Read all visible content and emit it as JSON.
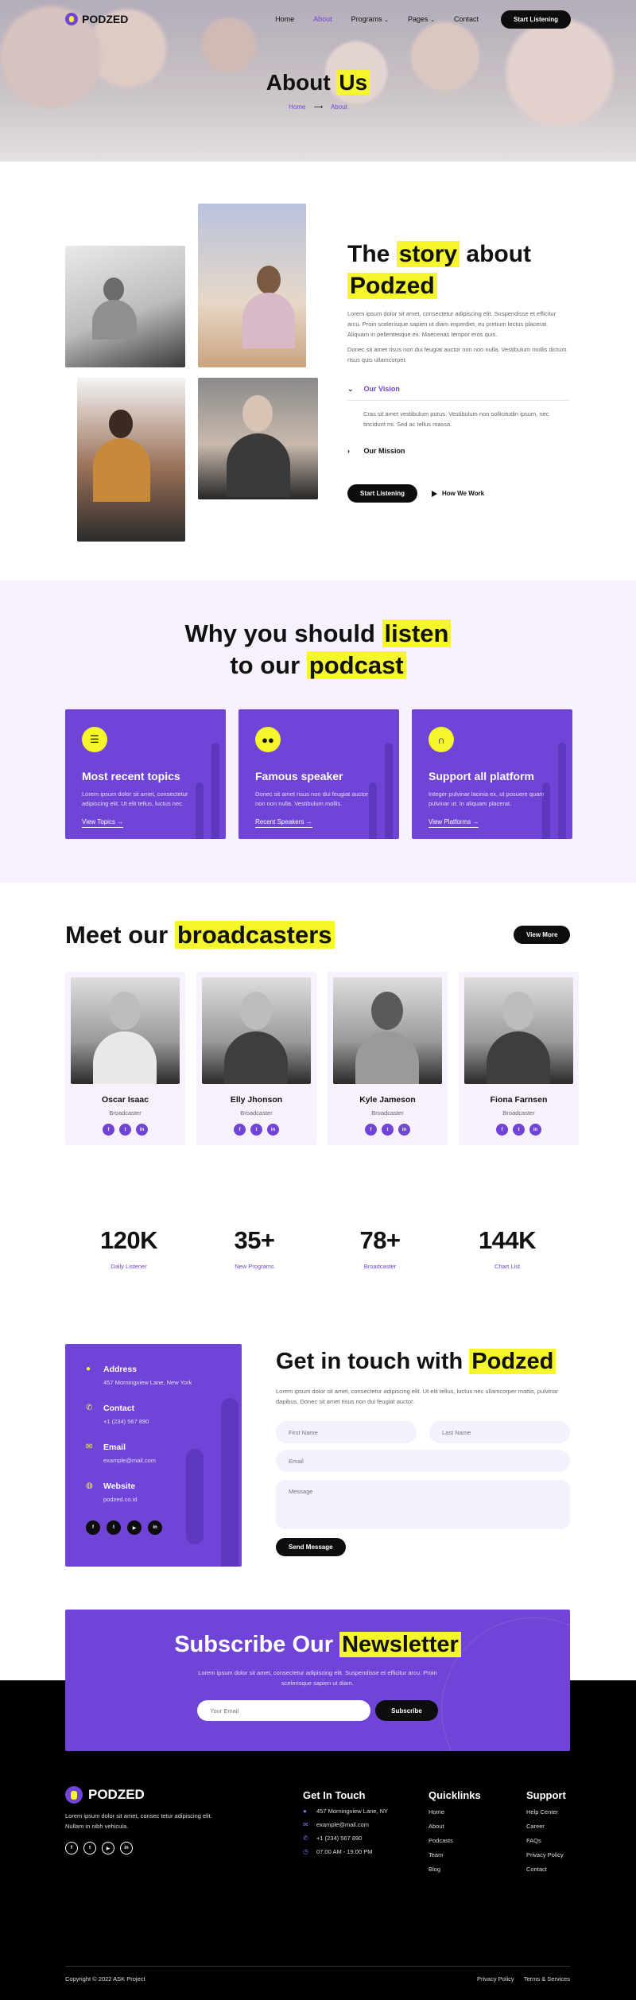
{
  "nav": {
    "logo": "PODZED",
    "items": [
      "Home",
      "About",
      "Programs",
      "Pages",
      "Contact"
    ],
    "cta": "Start Listening"
  },
  "hero": {
    "title_plain": "About",
    "title_highlight": "Us",
    "breadcrumb": [
      "Home",
      "About"
    ]
  },
  "story": {
    "title_1": "The",
    "title_highlight_1": "story",
    "title_2": "about",
    "title_highlight_2": "Podzed",
    "p1": "Lorem ipsum dolor sit amet, consectetur adipiscing elit. Suspendisse et efficitur arcu. Proin scelerisque sapien ut diam imperdiet, eu pretium lectus placerat. Aliquam in pellentesque ex. Maecenas tempor eros quis.",
    "p2": "Donec sit amet risus non dui feugiat auctor non non nulla. Vestibulum mollis dictum risus quis ullamcorper.",
    "accordion": [
      {
        "label": "Our Vision",
        "body": "Cras sit amet vestibulum purus. Vestibulum non sollicitudin ipsum, nec tincidunt mi. Sed ac tellus massa."
      },
      {
        "label": "Our Mission"
      }
    ],
    "btn_primary": "Start Listening",
    "btn_secondary": "How We Work"
  },
  "why": {
    "title_1": "Why you should",
    "title_highlight_1": "listen",
    "title_2": "to our",
    "title_highlight_2": "podcast",
    "cards": [
      {
        "icon": "list-icon",
        "title": "Most recent topics",
        "text": "Lorem ipsum dolor sit amet, consectetur adipiscing elit. Ut elit tellus, luctus nec.",
        "link": "View Topics"
      },
      {
        "icon": "users-icon",
        "title": "Famous speaker",
        "text": "Donec sit amet risus non dui feugiat auctor non non nulla. Vestibulum mollis.",
        "link": "Recent Speakers"
      },
      {
        "icon": "headphones-icon",
        "title": "Support all platform",
        "text": "Integer pulvinar lacinia ex, ut posuere quam pulvinar ut. In aliquam placerat.",
        "link": "View Platforms"
      }
    ]
  },
  "broadcasters": {
    "title_plain": "Meet our",
    "title_highlight": "broadcasters",
    "button": "View More",
    "people": [
      {
        "name": "Oscar Isaac",
        "role": "Broadcaster"
      },
      {
        "name": "Elly Jhonson",
        "role": "Broadcaster"
      },
      {
        "name": "Kyle Jameson",
        "role": "Broadcaster"
      },
      {
        "name": "Fiona Farnsen",
        "role": "Broadcaster"
      }
    ]
  },
  "stats": [
    {
      "num": "120K",
      "label": "Daily Listener"
    },
    {
      "num": "35+",
      "label": "New Programs"
    },
    {
      "num": "78+",
      "label": "Broadcaster"
    },
    {
      "num": "144K",
      "label": "Chart List"
    }
  ],
  "contact": {
    "info": [
      {
        "icon": "map-pin-icon",
        "title": "Address",
        "value": "457 Morningview Lane, New York"
      },
      {
        "icon": "phone-icon",
        "title": "Contact",
        "value": "+1 (234) 567 890"
      },
      {
        "icon": "mail-icon",
        "title": "Email",
        "value": "example@mail.com"
      },
      {
        "icon": "globe-icon",
        "title": "Website",
        "value": "podzed.co.id"
      }
    ],
    "title_plain": "Get in touch with",
    "title_highlight": "Podzed",
    "text": "Lorem ipsum dolor sit amet, consectetur adipiscing elit. Ut elit tellus, luctus nec ullamcorper mattis, pulvinar dapibus. Donec sit amet risus non dui feugiat auctor.",
    "placeholders": {
      "first": "First Name",
      "last": "Last Name",
      "email": "Email",
      "message": "Message"
    },
    "send": "Send Message"
  },
  "newsletter": {
    "title_plain": "Subscribe Our",
    "title_highlight": "Newsletter",
    "text": "Lorem ipsum dolor sit amet, consectetur adipiscing elit. Suspendisse et efficitur arcu. Proin scelerisque sapien ut diam.",
    "placeholder": "Your Email",
    "button": "Subscribe"
  },
  "footer": {
    "logo": "PODZED",
    "desc": "Lorem ipsum dolor sit amet, consec tetur adipiscing elit. Nullam in nibh vehicula.",
    "touch_title": "Get In Touch",
    "touch": [
      {
        "icon": "map-pin-icon",
        "text": "457 Morningview Lane, NY"
      },
      {
        "icon": "mail-icon",
        "text": "example@mail.com"
      },
      {
        "icon": "phone-icon",
        "text": "+1 (234) 567 890"
      },
      {
        "icon": "clock-icon",
        "text": "07.00 AM - 19.00 PM"
      }
    ],
    "quick_title": "Quicklinks",
    "quick": [
      "Home",
      "About",
      "Podcasts",
      "Team",
      "Blog"
    ],
    "support_title": "Support",
    "support": [
      "Help Center",
      "Career",
      "FAQs",
      "Privacy Policy",
      "Contact"
    ],
    "copyright": "Copyright © 2022 ASK Project",
    "legal": [
      "Privacy Policy",
      "Terms & Services"
    ]
  },
  "colors": {
    "accent": "#6f44d6",
    "highlight": "#f5f62b",
    "dark": "#0d0d0d",
    "soft": "#f7f2fd"
  }
}
